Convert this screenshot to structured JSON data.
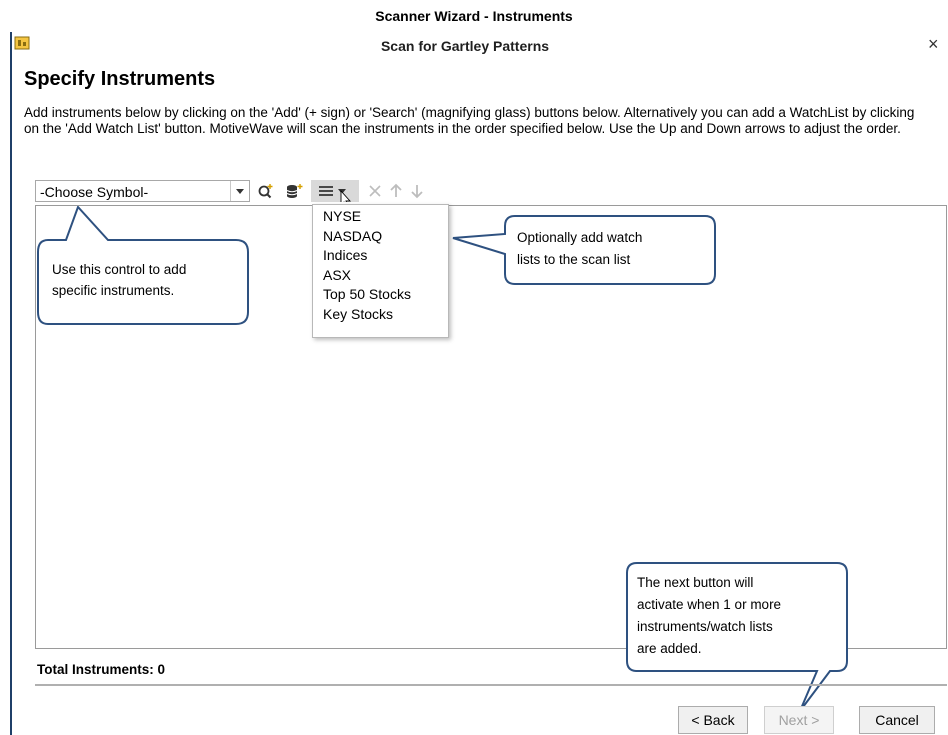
{
  "document_title": "Scanner Wizard - Instruments",
  "window": {
    "title": "Scan for Gartley Patterns",
    "close_glyph": "×"
  },
  "page": {
    "heading": "Specify Instruments",
    "instructions": "Add instruments below by clicking on the 'Add' (+ sign) or 'Search' (magnifying glass) buttons below. Alternatively you can add a WatchList by clicking on the 'Add Watch List' button.  MotiveWave will scan the instruments in the order specified below.  Use the Up and Down arrows to adjust the order."
  },
  "toolbar": {
    "symbol_combo_value": "-Choose Symbol-",
    "icons": [
      "search-add-icon",
      "database-add-icon",
      "watchlist-menu-icon",
      "remove-icon",
      "move-up-icon",
      "move-down-icon"
    ]
  },
  "watchlist_menu": {
    "items": [
      "NYSE",
      "NASDAQ",
      "Indices",
      "ASX",
      "Top 50 Stocks",
      "Key Stocks"
    ]
  },
  "callouts": {
    "symbol": [
      "Use this control to add",
      "specific instruments."
    ],
    "watchlist": [
      "Optionally add watch",
      "lists to the scan list"
    ],
    "next": [
      "The next button will",
      "activate when 1 or more",
      "instruments/watch lists",
      "are added."
    ]
  },
  "footer": {
    "total_instruments": "Total Instruments: 0",
    "back_label": "< Back",
    "next_label": "Next >",
    "cancel_label": "Cancel"
  },
  "colors": {
    "callout_border": "#2e5180",
    "frame": "#1f3f68",
    "disabled_text": "#a0a0a0"
  }
}
